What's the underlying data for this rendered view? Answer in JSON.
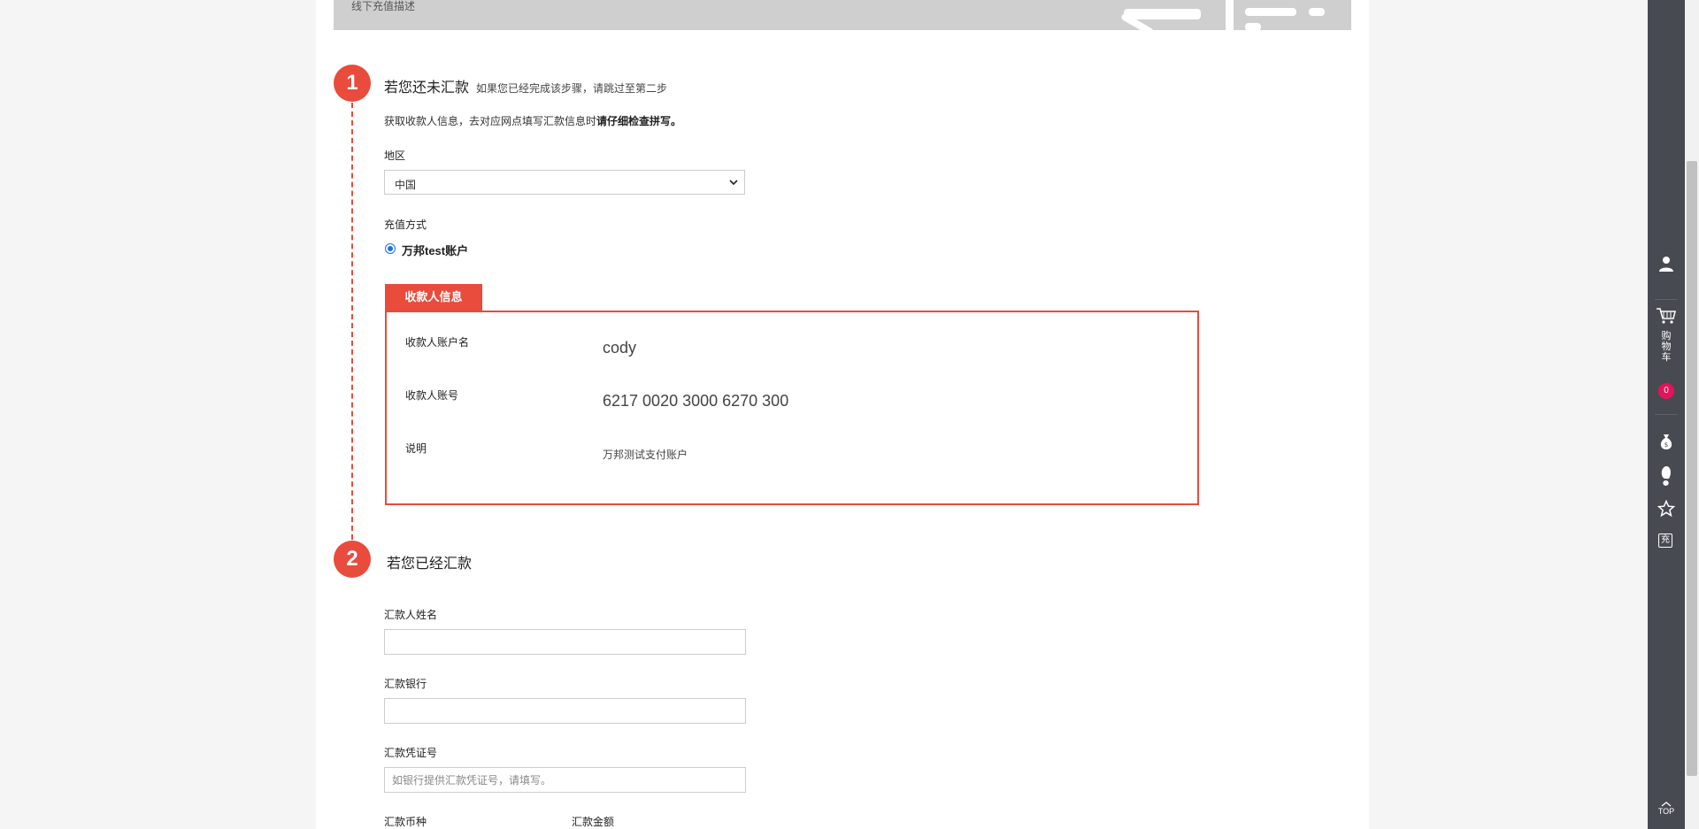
{
  "banner": {
    "text": "线下充值描述"
  },
  "step1": {
    "number": "1",
    "title": "若您还未汇款",
    "subtitle": "如果您已经完成该步骤，请跳过至第二步",
    "note_prefix": "获取收款人信息，去对应网点填写汇款信息时",
    "note_bold": "请仔细检查拼写。",
    "region": {
      "label": "地区",
      "value": "中国"
    },
    "method": {
      "label": "充值方式",
      "option": "万邦test账户"
    },
    "payee": {
      "tab": "收款人信息",
      "account_name_label": "收款人账户名",
      "account_name": "cody",
      "account_no_label": "收款人账号",
      "account_no": "6217 0020 3000 6270 300",
      "desc_label": "说明",
      "desc": "万邦测试支付账户"
    }
  },
  "step2": {
    "number": "2",
    "title": "若您已经汇款",
    "remitter_name_label": "汇款人姓名",
    "bank_label": "汇款银行",
    "voucher_label": "汇款凭证号",
    "voucher_placeholder": "如银行提供汇款凭证号，请填写。",
    "currency_label": "汇款币种",
    "amount_label": "汇款金额"
  },
  "sidebar": {
    "cart_label": "购物车",
    "cart_count": "0",
    "recharge_label": "充",
    "top_label": "TOP"
  },
  "colors": {
    "accent": "#e94b3c",
    "sidebar": "#474a51",
    "badge": "#e6125a"
  },
  "icons": [
    "user-icon",
    "cart-icon",
    "money-bag-icon",
    "footprint-icon",
    "star-icon",
    "recharge-icon",
    "back-to-top-icon",
    "chevron-down-icon"
  ]
}
